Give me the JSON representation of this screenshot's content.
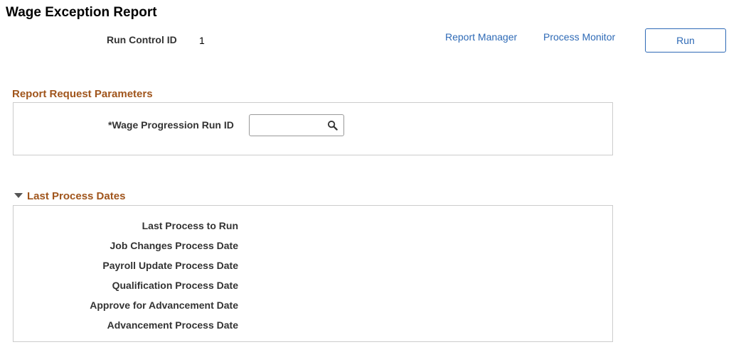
{
  "page": {
    "title": "Wage Exception Report"
  },
  "run_control": {
    "label": "Run Control ID",
    "value": "1"
  },
  "toolbar": {
    "report_manager": "Report Manager",
    "process_monitor": "Process Monitor",
    "run_label": "Run"
  },
  "params_section": {
    "title": "Report Request Parameters",
    "wage_run_id_label": "*Wage Progression Run ID",
    "wage_run_id_value": "",
    "search_icon": "search-icon"
  },
  "dates_section": {
    "title": "Last Process Dates",
    "collapse_icon": "triangle-down-icon",
    "rows": [
      {
        "label": "Last Process to Run"
      },
      {
        "label": "Job Changes Process Date"
      },
      {
        "label": "Payroll Update Process Date"
      },
      {
        "label": "Qualification Process Date"
      },
      {
        "label": "Approve for Advancement Date"
      },
      {
        "label": "Advancement Process Date"
      }
    ]
  },
  "colors": {
    "link": "#2e6ab6",
    "section_title": "#a0551c",
    "border": "#cccccc"
  }
}
